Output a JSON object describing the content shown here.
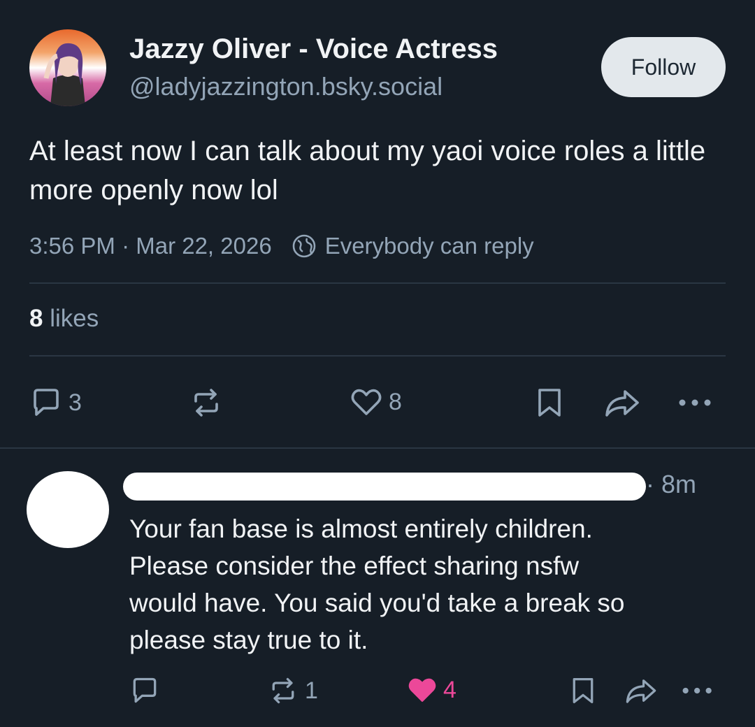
{
  "post": {
    "author_name": "Jazzy Oliver - Voice Actress",
    "author_handle": "@ladyjazzington.bsky.social",
    "follow_label": "Follow",
    "text": "At least now I can talk about my yaoi voice roles a little more openly now lol",
    "timestamp": "3:56 PM · Mar 22, 2026",
    "reply_setting": "Everybody can reply",
    "likes_count": "8",
    "likes_label": "likes",
    "actions": {
      "reply_count": "3",
      "repost_count": "",
      "like_count": "8"
    }
  },
  "reply": {
    "time": "· 8m",
    "text_lines": [
      "Your fan base is almost entirely children.",
      "Please consider the effect sharing nsfw",
      "would have. You said you'd take a break so",
      "please stay true to it."
    ],
    "actions": {
      "reply_count": "",
      "repost_count": "1",
      "like_count": "4",
      "liked": true
    }
  },
  "icons": {
    "reply": "speech-bubble-icon",
    "repost": "repost-icon",
    "like": "heart-icon",
    "bookmark": "bookmark-icon",
    "share": "share-arrow-icon",
    "more": "more-dots-icon",
    "globe": "globe-icon"
  },
  "colors": {
    "background": "#161e27",
    "muted_text": "#93a5b7",
    "primary_text": "#f1f3f5",
    "like_active": "#ec4899",
    "follow_button_bg": "#e3e8ec"
  }
}
